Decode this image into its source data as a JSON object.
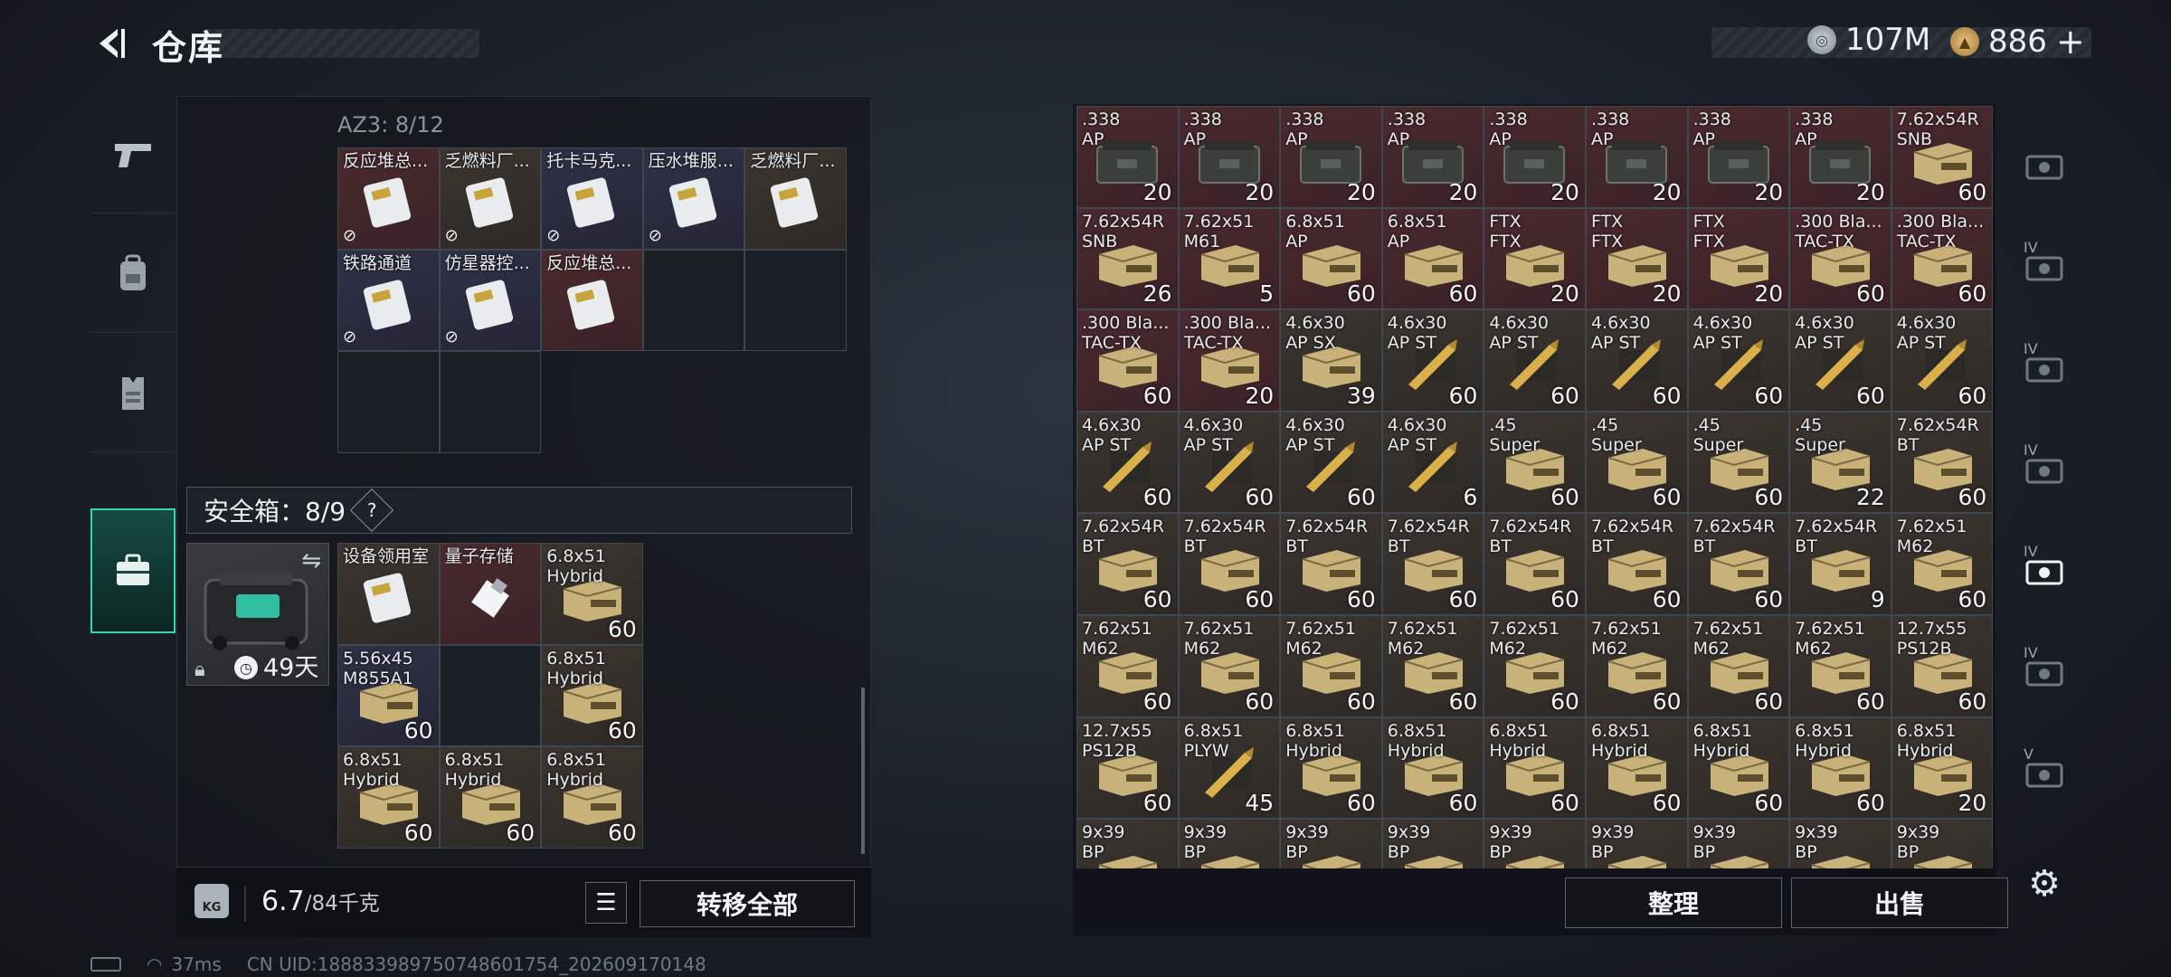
{
  "header": {
    "title": "仓库",
    "currency1_value": "107M",
    "currency2_value": "886",
    "add_label": "+"
  },
  "colors": {
    "accent": "#2fd6b0",
    "rare_red": "#4a2a2e",
    "rare_gold": "#4a3e2a",
    "rare_purple": "#2f3146"
  },
  "container": {
    "label": "AZ3: 8/12",
    "items": [
      {
        "name": "反应堆总...",
        "rarity": "red",
        "icon": "keycard-icon",
        "locked": true
      },
      {
        "name": "乏燃料厂...",
        "rarity": "brown",
        "icon": "keycard-icon",
        "locked": true
      },
      {
        "name": "托卡马克...",
        "rarity": "purple",
        "icon": "keycard-icon",
        "locked": true
      },
      {
        "name": "压水堆服...",
        "rarity": "purple",
        "icon": "keycard-icon",
        "locked": true
      },
      {
        "name": "乏燃料厂...",
        "rarity": "brown",
        "icon": "keycard-icon",
        "locked": false
      },
      {
        "name": "铁路通道",
        "rarity": "purple",
        "icon": "keycard-icon",
        "locked": true
      },
      {
        "name": "仿星器控...",
        "rarity": "purple",
        "icon": "keycard-icon",
        "locked": true
      },
      {
        "name": "反应堆总...",
        "rarity": "red",
        "icon": "keycard-icon",
        "locked": false
      }
    ]
  },
  "safe": {
    "label": "安全箱：8/9",
    "help": "?",
    "days": "49天",
    "items": [
      {
        "name": "设备领用室",
        "rarity": "brown",
        "icon": "keycard-icon",
        "count": ""
      },
      {
        "name": "量子存储",
        "rarity": "red",
        "icon": "usb-icon",
        "count": ""
      },
      {
        "name": "6.8x51\nHybrid",
        "rarity": "brown",
        "icon": "ammo-box-icon",
        "count": "60"
      },
      {
        "name": "5.56x45\nM855A1",
        "rarity": "purple",
        "icon": "ammo-box-icon",
        "count": "60"
      },
      {
        "name": "",
        "rarity": "empty",
        "icon": "",
        "count": ""
      },
      {
        "name": "6.8x51\nHybrid",
        "rarity": "brown",
        "icon": "ammo-box-icon",
        "count": "60"
      },
      {
        "name": "6.8x51\nHybrid",
        "rarity": "brown",
        "icon": "ammo-box-icon",
        "count": "60"
      },
      {
        "name": "6.8x51\nHybrid",
        "rarity": "brown",
        "icon": "ammo-box-icon",
        "count": "60"
      },
      {
        "name": "6.8x51\nHybrid",
        "rarity": "brown",
        "icon": "ammo-box-icon",
        "count": "60"
      }
    ]
  },
  "bottom_left": {
    "weight": "6.7",
    "weight_max": "/84千克",
    "transfer_all": "转移全部"
  },
  "bottom_right": {
    "sort": "整理",
    "sell": "出售"
  },
  "status": {
    "ping": "37ms",
    "uid": "CN UID:18883398975074860​1754_202609170148"
  },
  "stash_items": [
    {
      "name": ".338\nAP",
      "count": "20",
      "rarity": "red",
      "icon": "ammo-crate-icon"
    },
    {
      "name": ".338\nAP",
      "count": "20",
      "rarity": "red",
      "icon": "ammo-crate-icon"
    },
    {
      "name": ".338\nAP",
      "count": "20",
      "rarity": "red",
      "icon": "ammo-crate-icon"
    },
    {
      "name": ".338\nAP",
      "count": "20",
      "rarity": "red",
      "icon": "ammo-crate-icon"
    },
    {
      "name": ".338\nAP",
      "count": "20",
      "rarity": "red",
      "icon": "ammo-crate-icon"
    },
    {
      "name": ".338\nAP",
      "count": "20",
      "rarity": "red",
      "icon": "ammo-crate-icon"
    },
    {
      "name": ".338\nAP",
      "count": "20",
      "rarity": "red",
      "icon": "ammo-crate-icon"
    },
    {
      "name": ".338\nAP",
      "count": "20",
      "rarity": "red",
      "icon": "ammo-crate-icon"
    },
    {
      "name": "7.62x54R\nSNB",
      "count": "60",
      "rarity": "red",
      "icon": "ammo-box-icon"
    },
    {
      "name": "7.62x54R\nSNB",
      "count": "26",
      "rarity": "red",
      "icon": "ammo-box-icon"
    },
    {
      "name": "7.62x51\nM61",
      "count": "5",
      "rarity": "red",
      "icon": "ammo-box-icon"
    },
    {
      "name": "6.8x51\nAP",
      "count": "60",
      "rarity": "red",
      "icon": "ammo-box-icon"
    },
    {
      "name": "6.8x51\nAP",
      "count": "60",
      "rarity": "red",
      "icon": "ammo-box-icon"
    },
    {
      "name": "FTX\nFTX",
      "count": "20",
      "rarity": "red",
      "icon": "ammo-box-icon"
    },
    {
      "name": "FTX\nFTX",
      "count": "20",
      "rarity": "red",
      "icon": "ammo-box-icon"
    },
    {
      "name": "FTX\nFTX",
      "count": "20",
      "rarity": "red",
      "icon": "ammo-box-icon"
    },
    {
      "name": ".300 Bla...\nTAC-TX",
      "count": "60",
      "rarity": "red",
      "icon": "ammo-box-icon"
    },
    {
      "name": ".300 Bla...\nTAC-TX",
      "count": "60",
      "rarity": "red",
      "icon": "ammo-box-icon"
    },
    {
      "name": ".300 Bla...\nTAC-TX",
      "count": "60",
      "rarity": "red",
      "icon": "ammo-box-icon"
    },
    {
      "name": ".300 Bla...\nTAC-TX",
      "count": "20",
      "rarity": "red",
      "icon": "ammo-box-icon"
    },
    {
      "name": "4.6x30\nAP SX",
      "count": "39",
      "rarity": "brown",
      "icon": "ammo-box-icon"
    },
    {
      "name": "4.6x30\nAP ST",
      "count": "60",
      "rarity": "brown",
      "icon": "bullet-icon"
    },
    {
      "name": "4.6x30\nAP ST",
      "count": "60",
      "rarity": "brown",
      "icon": "bullet-icon"
    },
    {
      "name": "4.6x30\nAP ST",
      "count": "60",
      "rarity": "brown",
      "icon": "bullet-icon"
    },
    {
      "name": "4.6x30\nAP ST",
      "count": "60",
      "rarity": "brown",
      "icon": "bullet-icon"
    },
    {
      "name": "4.6x30\nAP ST",
      "count": "60",
      "rarity": "brown",
      "icon": "bullet-icon"
    },
    {
      "name": "4.6x30\nAP ST",
      "count": "60",
      "rarity": "brown",
      "icon": "bullet-icon"
    },
    {
      "name": "4.6x30\nAP ST",
      "count": "60",
      "rarity": "brown",
      "icon": "bullet-icon"
    },
    {
      "name": "4.6x30\nAP ST",
      "count": "60",
      "rarity": "brown",
      "icon": "bullet-icon"
    },
    {
      "name": "4.6x30\nAP ST",
      "count": "60",
      "rarity": "brown",
      "icon": "bullet-icon"
    },
    {
      "name": "4.6x30\nAP ST",
      "count": "6",
      "rarity": "brown",
      "icon": "bullet-icon"
    },
    {
      "name": ".45\nSuper",
      "count": "60",
      "rarity": "brown",
      "icon": "ammo-box-icon"
    },
    {
      "name": ".45\nSuper",
      "count": "60",
      "rarity": "brown",
      "icon": "ammo-box-icon"
    },
    {
      "name": ".45\nSuper",
      "count": "60",
      "rarity": "brown",
      "icon": "ammo-box-icon"
    },
    {
      "name": ".45\nSuper",
      "count": "22",
      "rarity": "brown",
      "icon": "ammo-box-icon"
    },
    {
      "name": "7.62x54R\nBT",
      "count": "60",
      "rarity": "brown",
      "icon": "ammo-box-icon"
    },
    {
      "name": "7.62x54R\nBT",
      "count": "60",
      "rarity": "brown",
      "icon": "ammo-box-icon"
    },
    {
      "name": "7.62x54R\nBT",
      "count": "60",
      "rarity": "brown",
      "icon": "ammo-box-icon"
    },
    {
      "name": "7.62x54R\nBT",
      "count": "60",
      "rarity": "brown",
      "icon": "ammo-box-icon"
    },
    {
      "name": "7.62x54R\nBT",
      "count": "60",
      "rarity": "brown",
      "icon": "ammo-box-icon"
    },
    {
      "name": "7.62x54R\nBT",
      "count": "60",
      "rarity": "brown",
      "icon": "ammo-box-icon"
    },
    {
      "name": "7.62x54R\nBT",
      "count": "60",
      "rarity": "brown",
      "icon": "ammo-box-icon"
    },
    {
      "name": "7.62x54R\nBT",
      "count": "60",
      "rarity": "brown",
      "icon": "ammo-box-icon"
    },
    {
      "name": "7.62x54R\nBT",
      "count": "9",
      "rarity": "brown",
      "icon": "ammo-box-icon"
    },
    {
      "name": "7.62x51\nM62",
      "count": "60",
      "rarity": "brown",
      "icon": "ammo-box-icon"
    },
    {
      "name": "7.62x51\nM62",
      "count": "60",
      "rarity": "brown",
      "icon": "ammo-box-icon"
    },
    {
      "name": "7.62x51\nM62",
      "count": "60",
      "rarity": "brown",
      "icon": "ammo-box-icon"
    },
    {
      "name": "7.62x51\nM62",
      "count": "60",
      "rarity": "brown",
      "icon": "ammo-box-icon"
    },
    {
      "name": "7.62x51\nM62",
      "count": "60",
      "rarity": "brown",
      "icon": "ammo-box-icon"
    },
    {
      "name": "7.62x51\nM62",
      "count": "60",
      "rarity": "brown",
      "icon": "ammo-box-icon"
    },
    {
      "name": "7.62x51\nM62",
      "count": "60",
      "rarity": "brown",
      "icon": "ammo-box-icon"
    },
    {
      "name": "7.62x51\nM62",
      "count": "60",
      "rarity": "brown",
      "icon": "ammo-box-icon"
    },
    {
      "name": "7.62x51\nM62",
      "count": "60",
      "rarity": "brown",
      "icon": "ammo-box-icon"
    },
    {
      "name": "12.7x55\nPS12B",
      "count": "60",
      "rarity": "brown",
      "icon": "ammo-box-icon"
    },
    {
      "name": "12.7x55\nPS12B",
      "count": "60",
      "rarity": "brown",
      "icon": "ammo-box-icon"
    },
    {
      "name": "6.8x51\nPLYW",
      "count": "45",
      "rarity": "brown",
      "icon": "bullet-icon"
    },
    {
      "name": "6.8x51\nHybrid",
      "count": "60",
      "rarity": "brown",
      "icon": "ammo-box-icon"
    },
    {
      "name": "6.8x51\nHybrid",
      "count": "60",
      "rarity": "brown",
      "icon": "ammo-box-icon"
    },
    {
      "name": "6.8x51\nHybrid",
      "count": "60",
      "rarity": "brown",
      "icon": "ammo-box-icon"
    },
    {
      "name": "6.8x51\nHybrid",
      "count": "60",
      "rarity": "brown",
      "icon": "ammo-box-icon"
    },
    {
      "name": "6.8x51\nHybrid",
      "count": "60",
      "rarity": "brown",
      "icon": "ammo-box-icon"
    },
    {
      "name": "6.8x51\nHybrid",
      "count": "60",
      "rarity": "brown",
      "icon": "ammo-box-icon"
    },
    {
      "name": "6.8x51\nHybrid",
      "count": "20",
      "rarity": "brown",
      "icon": "ammo-box-icon"
    },
    {
      "name": "9x39\nBP",
      "count": "",
      "rarity": "brown",
      "icon": "ammo-box-icon"
    },
    {
      "name": "9x39\nBP",
      "count": "",
      "rarity": "brown",
      "icon": "ammo-box-icon"
    },
    {
      "name": "9x39\nBP",
      "count": "",
      "rarity": "brown",
      "icon": "ammo-box-icon"
    },
    {
      "name": "9x39\nBP",
      "count": "",
      "rarity": "brown",
      "icon": "ammo-box-icon"
    },
    {
      "name": "9x39\nBP",
      "count": "",
      "rarity": "brown",
      "icon": "ammo-box-icon"
    },
    {
      "name": "9x39\nBP",
      "count": "",
      "rarity": "brown",
      "icon": "ammo-box-icon"
    },
    {
      "name": "9x39\nBP",
      "count": "",
      "rarity": "brown",
      "icon": "ammo-box-icon"
    },
    {
      "name": "9x39\nBP",
      "count": "",
      "rarity": "brown",
      "icon": "ammo-box-icon"
    },
    {
      "name": "9x39\nBP",
      "count": "",
      "rarity": "brown",
      "icon": "ammo-box-icon"
    }
  ],
  "right_tabs": [
    {
      "label": "",
      "icon": "helmet-icon"
    },
    {
      "label": "IV",
      "icon": "equipment-set-icon"
    },
    {
      "label": "IV",
      "icon": "equipment-set-icon"
    },
    {
      "label": "IV",
      "icon": "equipment-set-icon"
    },
    {
      "label": "IV",
      "icon": "equipment-set-icon"
    },
    {
      "label": "IV",
      "icon": "equipment-set-icon"
    },
    {
      "label": "V",
      "icon": "equipment-set-icon"
    }
  ]
}
